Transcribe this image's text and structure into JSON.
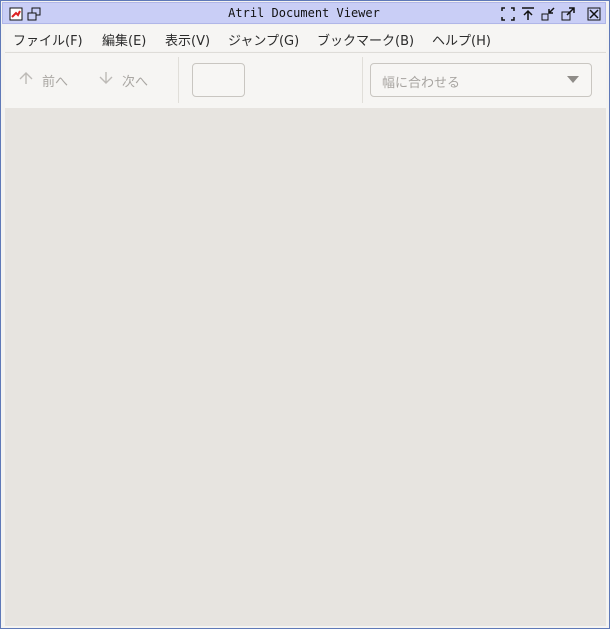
{
  "window": {
    "title": "Atril Document Viewer"
  },
  "menubar": {
    "items": [
      "ファイル(F)",
      "編集(E)",
      "表示(V)",
      "ジャンプ(G)",
      "ブックマーク(B)",
      "ヘルプ(H)"
    ]
  },
  "toolbar": {
    "prev_label": "前へ",
    "next_label": "次へ",
    "page_value": "",
    "zoom_value": "幅に合わせる"
  },
  "icons": {
    "app": "atril-app-icon",
    "restore": "window-restore-icon",
    "fullscreen": "fullscreen-icon",
    "keep_above": "keep-above-icon",
    "minimize": "minimize-icon",
    "maximize": "maximize-icon",
    "close": "close-icon",
    "prev": "arrow-up-icon",
    "next": "arrow-down-icon",
    "dropdown": "dropdown-arrow-icon"
  },
  "colors": {
    "titlebar": "#c9cef6",
    "window_border": "#5f79b8",
    "content": "#e7e4e0"
  }
}
